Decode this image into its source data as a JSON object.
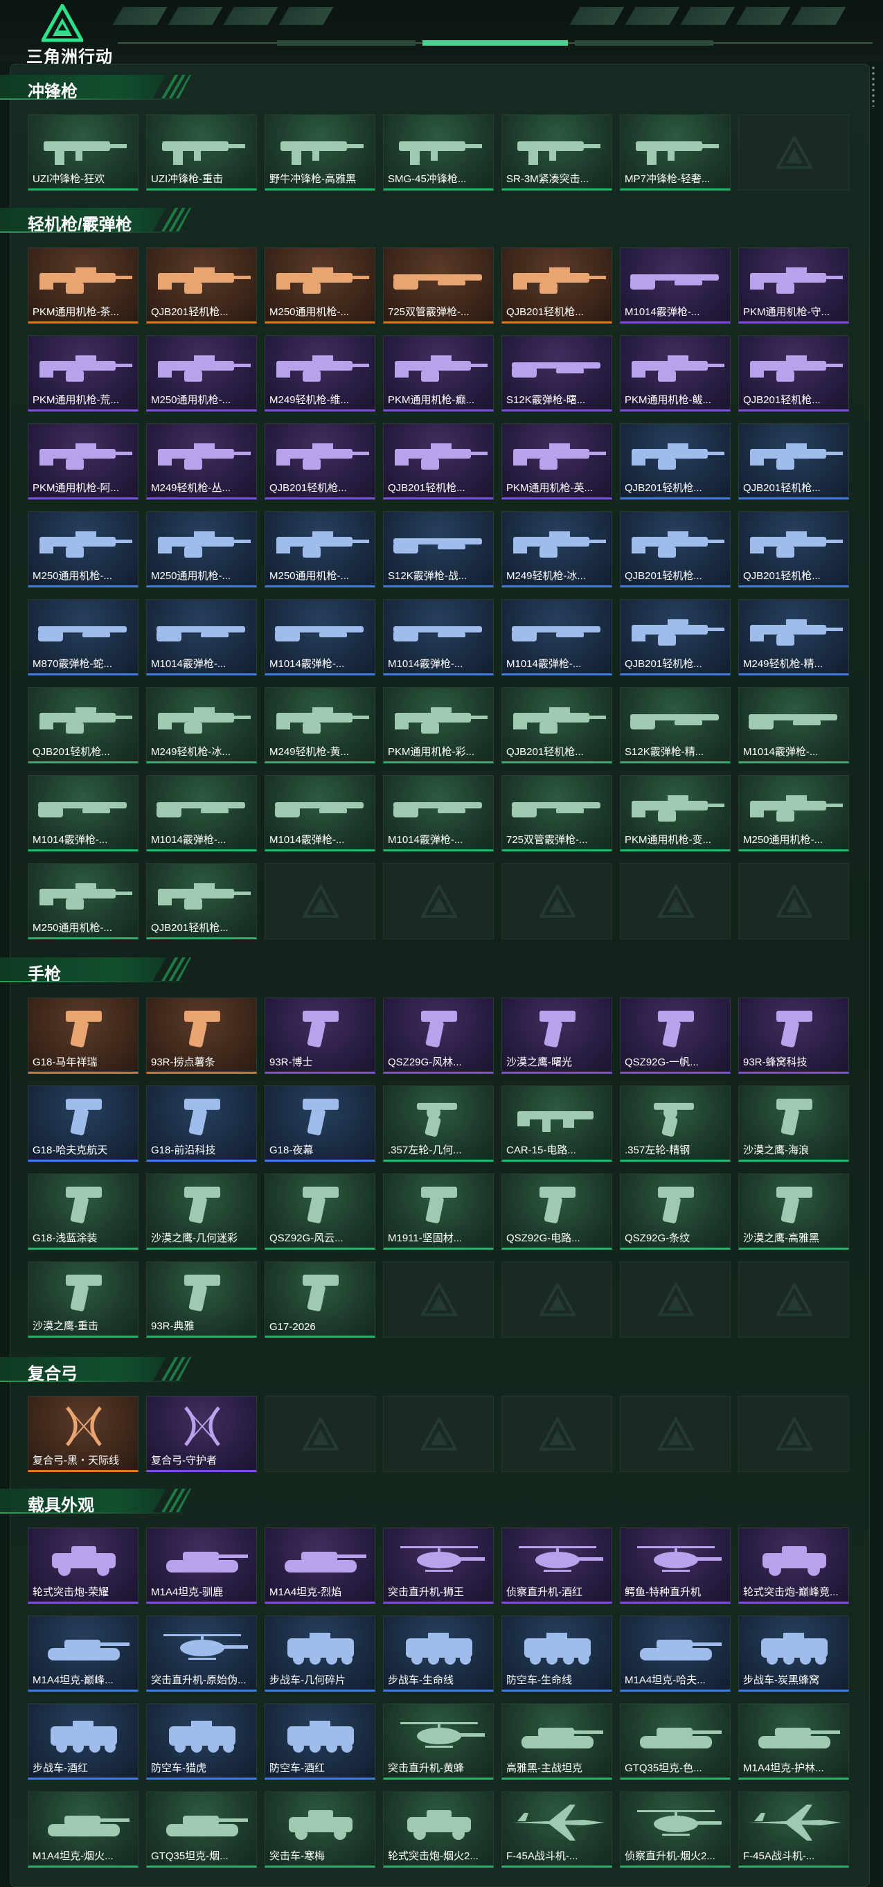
{
  "app": {
    "logo_text": "三角洲行动",
    "colors": {
      "green": "#27b36b",
      "orange": "#d9772b",
      "purple": "#7f4fe0",
      "blue": "#3e7ee0"
    }
  },
  "sections": [
    {
      "title": "冲锋枪",
      "items": [
        {
          "name": "UZI冲锋枪-狂欢",
          "rarity": "green",
          "icon": "smg-icon"
        },
        {
          "name": "UZI冲锋枪-重击",
          "rarity": "green",
          "icon": "smg-icon"
        },
        {
          "name": "野牛冲锋枪-高雅黑",
          "rarity": "green",
          "icon": "smg-icon"
        },
        {
          "name": "SMG-45冲锋枪...",
          "rarity": "green",
          "icon": "smg-icon"
        },
        {
          "name": "SR-3M紧凑突击...",
          "rarity": "green",
          "icon": "smg-icon"
        },
        {
          "name": "MP7冲锋枪-轻奢...",
          "rarity": "green",
          "icon": "smg-icon"
        },
        {
          "name": "",
          "rarity": "empty",
          "icon": "placeholder-icon"
        }
      ]
    },
    {
      "title": "轻机枪/霰弹枪",
      "items": [
        {
          "name": "PKM通用机枪-茶...",
          "rarity": "orange",
          "icon": "lmg-icon"
        },
        {
          "name": "QJB201轻机枪...",
          "rarity": "orange",
          "icon": "lmg-icon"
        },
        {
          "name": "M250通用机枪-...",
          "rarity": "orange",
          "icon": "lmg-icon"
        },
        {
          "name": "725双管霰弹枪-...",
          "rarity": "orange",
          "icon": "shotgun-icon"
        },
        {
          "name": "QJB201轻机枪...",
          "rarity": "orange",
          "icon": "lmg-icon"
        },
        {
          "name": "M1014霰弹枪-...",
          "rarity": "purple",
          "icon": "shotgun-icon"
        },
        {
          "name": "PKM通用机枪-守...",
          "rarity": "purple",
          "icon": "lmg-icon"
        },
        {
          "name": "PKM通用机枪-荒...",
          "rarity": "purple",
          "icon": "lmg-icon"
        },
        {
          "name": "M250通用机枪-...",
          "rarity": "purple",
          "icon": "lmg-icon"
        },
        {
          "name": "M249轻机枪-维...",
          "rarity": "purple",
          "icon": "lmg-icon"
        },
        {
          "name": "PKM通用机枪-癫...",
          "rarity": "purple",
          "icon": "lmg-icon"
        },
        {
          "name": "S12K霰弹枪-曙...",
          "rarity": "purple",
          "icon": "shotgun-icon"
        },
        {
          "name": "PKM通用机枪-鲅...",
          "rarity": "purple",
          "icon": "lmg-icon"
        },
        {
          "name": "QJB201轻机枪...",
          "rarity": "purple",
          "icon": "lmg-icon"
        },
        {
          "name": "PKM通用机枪-阿...",
          "rarity": "purple",
          "icon": "lmg-icon"
        },
        {
          "name": "M249轻机枪-丛...",
          "rarity": "purple",
          "icon": "lmg-icon"
        },
        {
          "name": "QJB201轻机枪...",
          "rarity": "purple",
          "icon": "lmg-icon"
        },
        {
          "name": "QJB201轻机枪...",
          "rarity": "purple",
          "icon": "lmg-icon"
        },
        {
          "name": "PKM通用机枪-英...",
          "rarity": "purple",
          "icon": "lmg-icon"
        },
        {
          "name": "QJB201轻机枪...",
          "rarity": "blue",
          "icon": "lmg-icon"
        },
        {
          "name": "QJB201轻机枪...",
          "rarity": "blue",
          "icon": "lmg-icon"
        },
        {
          "name": "M250通用机枪-...",
          "rarity": "blue",
          "icon": "lmg-icon"
        },
        {
          "name": "M250通用机枪-...",
          "rarity": "blue",
          "icon": "lmg-icon"
        },
        {
          "name": "M250通用机枪-...",
          "rarity": "blue",
          "icon": "lmg-icon"
        },
        {
          "name": "S12K霰弹枪-战...",
          "rarity": "blue",
          "icon": "shotgun-icon"
        },
        {
          "name": "M249轻机枪-冰...",
          "rarity": "blue",
          "icon": "lmg-icon"
        },
        {
          "name": "QJB201轻机枪...",
          "rarity": "blue",
          "icon": "lmg-icon"
        },
        {
          "name": "QJB201轻机枪...",
          "rarity": "blue",
          "icon": "lmg-icon"
        },
        {
          "name": "M870霰弹枪-蛇...",
          "rarity": "blue",
          "icon": "shotgun-icon"
        },
        {
          "name": "M1014霰弹枪-...",
          "rarity": "blue",
          "icon": "shotgun-icon"
        },
        {
          "name": "M1014霰弹枪-...",
          "rarity": "blue",
          "icon": "shotgun-icon"
        },
        {
          "name": "M1014霰弹枪-...",
          "rarity": "blue",
          "icon": "shotgun-icon"
        },
        {
          "name": "M1014霰弹枪-...",
          "rarity": "blue",
          "icon": "shotgun-icon"
        },
        {
          "name": "QJB201轻机枪...",
          "rarity": "blue",
          "icon": "lmg-icon"
        },
        {
          "name": "M249轻机枪-精...",
          "rarity": "blue",
          "icon": "lmg-icon"
        },
        {
          "name": "QJB201轻机枪...",
          "rarity": "green",
          "icon": "lmg-icon"
        },
        {
          "name": "M249轻机枪-冰...",
          "rarity": "green",
          "icon": "lmg-icon"
        },
        {
          "name": "M249轻机枪-黄...",
          "rarity": "green",
          "icon": "lmg-icon"
        },
        {
          "name": "PKM通用机枪-彩...",
          "rarity": "green",
          "icon": "lmg-icon"
        },
        {
          "name": "QJB201轻机枪...",
          "rarity": "green",
          "icon": "lmg-icon"
        },
        {
          "name": "S12K霰弹枪-精...",
          "rarity": "green",
          "icon": "shotgun-icon"
        },
        {
          "name": "M1014霰弹枪-...",
          "rarity": "green",
          "icon": "shotgun-icon"
        },
        {
          "name": "M1014霰弹枪-...",
          "rarity": "green",
          "icon": "shotgun-icon"
        },
        {
          "name": "M1014霰弹枪-...",
          "rarity": "green",
          "icon": "shotgun-icon"
        },
        {
          "name": "M1014霰弹枪-...",
          "rarity": "green",
          "icon": "shotgun-icon"
        },
        {
          "name": "M1014霰弹枪-...",
          "rarity": "green",
          "icon": "shotgun-icon"
        },
        {
          "name": "725双管霰弹枪-...",
          "rarity": "green",
          "icon": "shotgun-icon"
        },
        {
          "name": "PKM通用机枪-变...",
          "rarity": "green",
          "icon": "lmg-icon"
        },
        {
          "name": "M250通用机枪-...",
          "rarity": "green",
          "icon": "lmg-icon"
        },
        {
          "name": "M250通用机枪-...",
          "rarity": "green",
          "icon": "lmg-icon"
        },
        {
          "name": "QJB201轻机枪...",
          "rarity": "green",
          "icon": "lmg-icon"
        },
        {
          "name": "",
          "rarity": "empty",
          "icon": "placeholder-icon"
        },
        {
          "name": "",
          "rarity": "empty",
          "icon": "placeholder-icon"
        },
        {
          "name": "",
          "rarity": "empty",
          "icon": "placeholder-icon"
        },
        {
          "name": "",
          "rarity": "empty",
          "icon": "placeholder-icon"
        },
        {
          "name": "",
          "rarity": "empty",
          "icon": "placeholder-icon"
        }
      ]
    },
    {
      "title": "手枪",
      "items": [
        {
          "name": "G18-马年祥瑞",
          "rarity": "orange",
          "icon": "pistol-icon"
        },
        {
          "name": "93R-捞点薯条",
          "rarity": "orange",
          "icon": "pistol-icon"
        },
        {
          "name": "93R-博士",
          "rarity": "purple",
          "icon": "pistol-icon"
        },
        {
          "name": "QSZ29G-风林...",
          "rarity": "purple",
          "icon": "pistol-icon"
        },
        {
          "name": "沙漠之鹰-曙光",
          "rarity": "purple",
          "icon": "pistol-icon"
        },
        {
          "name": "QSZ92G-一帆...",
          "rarity": "purple",
          "icon": "pistol-icon"
        },
        {
          "name": "93R-蜂窝科技",
          "rarity": "purple",
          "icon": "pistol-icon"
        },
        {
          "name": "G18-哈夫克航天",
          "rarity": "blue",
          "icon": "pistol-icon"
        },
        {
          "name": "G18-前沿科技",
          "rarity": "blue",
          "icon": "pistol-icon"
        },
        {
          "name": "G18-夜幕",
          "rarity": "blue",
          "icon": "pistol-icon"
        },
        {
          "name": ".357左轮-几何...",
          "rarity": "green",
          "icon": "revolver-icon"
        },
        {
          "name": "CAR-15-电路...",
          "rarity": "green",
          "icon": "rifle-icon"
        },
        {
          "name": ".357左轮-精钢",
          "rarity": "green",
          "icon": "revolver-icon"
        },
        {
          "name": "沙漠之鹰-海浪",
          "rarity": "green",
          "icon": "pistol-icon"
        },
        {
          "name": "G18-浅蓝涂装",
          "rarity": "green",
          "icon": "pistol-icon"
        },
        {
          "name": "沙漠之鹰-几何迷彩",
          "rarity": "green",
          "icon": "pistol-icon"
        },
        {
          "name": "QSZ92G-风云...",
          "rarity": "green",
          "icon": "pistol-icon"
        },
        {
          "name": "M1911-坚固材...",
          "rarity": "green",
          "icon": "pistol-icon"
        },
        {
          "name": "QSZ92G-电路...",
          "rarity": "green",
          "icon": "pistol-icon"
        },
        {
          "name": "QSZ92G-条纹",
          "rarity": "green",
          "icon": "pistol-icon"
        },
        {
          "name": "沙漠之鹰-高雅黑",
          "rarity": "green",
          "icon": "pistol-icon"
        },
        {
          "name": "沙漠之鹰-重击",
          "rarity": "green",
          "icon": "pistol-icon"
        },
        {
          "name": "93R-典雅",
          "rarity": "green",
          "icon": "pistol-icon"
        },
        {
          "name": "G17-2026",
          "rarity": "green",
          "icon": "pistol-icon"
        },
        {
          "name": "",
          "rarity": "empty",
          "icon": "placeholder-icon"
        },
        {
          "name": "",
          "rarity": "empty",
          "icon": "placeholder-icon"
        },
        {
          "name": "",
          "rarity": "empty",
          "icon": "placeholder-icon"
        },
        {
          "name": "",
          "rarity": "empty",
          "icon": "placeholder-icon"
        }
      ]
    },
    {
      "title": "复合弓",
      "items": [
        {
          "name": "复合弓-黑・天际线",
          "rarity": "orange",
          "icon": "bow-icon"
        },
        {
          "name": "复合弓-守护者",
          "rarity": "purple",
          "icon": "bow-icon"
        },
        {
          "name": "",
          "rarity": "empty",
          "icon": "placeholder-icon"
        },
        {
          "name": "",
          "rarity": "empty",
          "icon": "placeholder-icon"
        },
        {
          "name": "",
          "rarity": "empty",
          "icon": "placeholder-icon"
        },
        {
          "name": "",
          "rarity": "empty",
          "icon": "placeholder-icon"
        },
        {
          "name": "",
          "rarity": "empty",
          "icon": "placeholder-icon"
        }
      ]
    },
    {
      "title": "载具外观",
      "items": [
        {
          "name": "轮式突击炮-荣耀",
          "rarity": "purple",
          "icon": "armored-car-icon"
        },
        {
          "name": "M1A4坦克-驯鹿",
          "rarity": "purple",
          "icon": "tank-icon"
        },
        {
          "name": "M1A4坦克-烈焰",
          "rarity": "purple",
          "icon": "tank-icon"
        },
        {
          "name": "突击直升机-狮王",
          "rarity": "purple",
          "icon": "helicopter-icon"
        },
        {
          "name": "侦察直升机-酒红",
          "rarity": "purple",
          "icon": "helicopter-icon"
        },
        {
          "name": "鳄鱼-特种直升机",
          "rarity": "purple",
          "icon": "helicopter-icon"
        },
        {
          "name": "轮式突击炮-巅峰竞...",
          "rarity": "purple",
          "icon": "armored-car-icon"
        },
        {
          "name": "M1A4坦克-巅峰...",
          "rarity": "blue",
          "icon": "tank-icon"
        },
        {
          "name": "突击直升机-原始伪...",
          "rarity": "blue",
          "icon": "helicopter-icon"
        },
        {
          "name": "步战车-几何碎片",
          "rarity": "blue",
          "icon": "ifv-icon"
        },
        {
          "name": "步战车-生命线",
          "rarity": "blue",
          "icon": "ifv-icon"
        },
        {
          "name": "防空车-生命线",
          "rarity": "blue",
          "icon": "ifv-icon"
        },
        {
          "name": "M1A4坦克-哈夫...",
          "rarity": "blue",
          "icon": "tank-icon"
        },
        {
          "name": "步战车-炭黑蜂窝",
          "rarity": "blue",
          "icon": "ifv-icon"
        },
        {
          "name": "步战车-酒红",
          "rarity": "blue",
          "icon": "ifv-icon"
        },
        {
          "name": "防空车-猎虎",
          "rarity": "blue",
          "icon": "ifv-icon"
        },
        {
          "name": "防空车-酒红",
          "rarity": "blue",
          "icon": "ifv-icon"
        },
        {
          "name": "突击直升机-黄蜂",
          "rarity": "green",
          "icon": "helicopter-icon"
        },
        {
          "name": "高雅黑-主战坦克",
          "rarity": "green",
          "icon": "tank-icon"
        },
        {
          "name": "GTQ35坦克-色...",
          "rarity": "green",
          "icon": "tank-icon"
        },
        {
          "name": "M1A4坦克-护林...",
          "rarity": "green",
          "icon": "tank-icon"
        },
        {
          "name": "M1A4坦克-烟火...",
          "rarity": "green",
          "icon": "tank-icon"
        },
        {
          "name": "GTQ35坦克-烟...",
          "rarity": "green",
          "icon": "tank-icon"
        },
        {
          "name": "突击车-寒梅",
          "rarity": "green",
          "icon": "armored-car-icon"
        },
        {
          "name": "轮式突击炮-烟火2...",
          "rarity": "green",
          "icon": "armored-car-icon"
        },
        {
          "name": "F-45A战斗机-...",
          "rarity": "green",
          "icon": "jet-icon"
        },
        {
          "name": "侦察直升机-烟火2...",
          "rarity": "green",
          "icon": "helicopter-icon"
        },
        {
          "name": "F-45A战斗机-...",
          "rarity": "green",
          "icon": "jet-icon"
        }
      ]
    }
  ]
}
